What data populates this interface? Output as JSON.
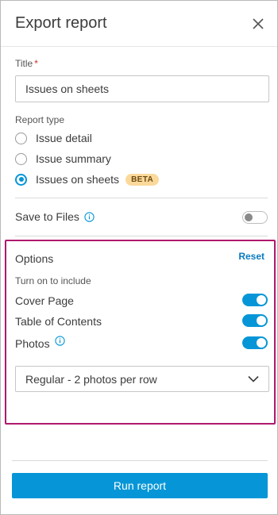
{
  "dialog": {
    "title": "Export report"
  },
  "form": {
    "title_label": "Title",
    "required_marker": "*",
    "title_value": "Issues on sheets",
    "report_type_label": "Report type",
    "report_types": [
      {
        "label": "Issue detail",
        "selected": false
      },
      {
        "label": "Issue summary",
        "selected": false
      },
      {
        "label": "Issues on sheets",
        "selected": true,
        "badge": "BETA"
      }
    ],
    "save_to_files_label": "Save to Files",
    "save_to_files_on": false
  },
  "options": {
    "heading": "Options",
    "reset_label": "Reset",
    "hint": "Turn on to include",
    "items": [
      {
        "label": "Cover Page",
        "on": true,
        "info": false
      },
      {
        "label": "Table of Contents",
        "on": true,
        "info": false
      },
      {
        "label": "Photos",
        "on": true,
        "info": true
      }
    ],
    "photos_layout_value": "Regular - 2 photos per row"
  },
  "footer": {
    "run_label": "Run report"
  },
  "colors": {
    "accent": "#0696d7",
    "highlight_border": "#b0186c",
    "badge_bg": "#fbd99b",
    "required": "#d02c2c"
  },
  "icons": {
    "close": "close-icon",
    "info": "info-icon",
    "dropdown": "chevron-down-icon"
  }
}
